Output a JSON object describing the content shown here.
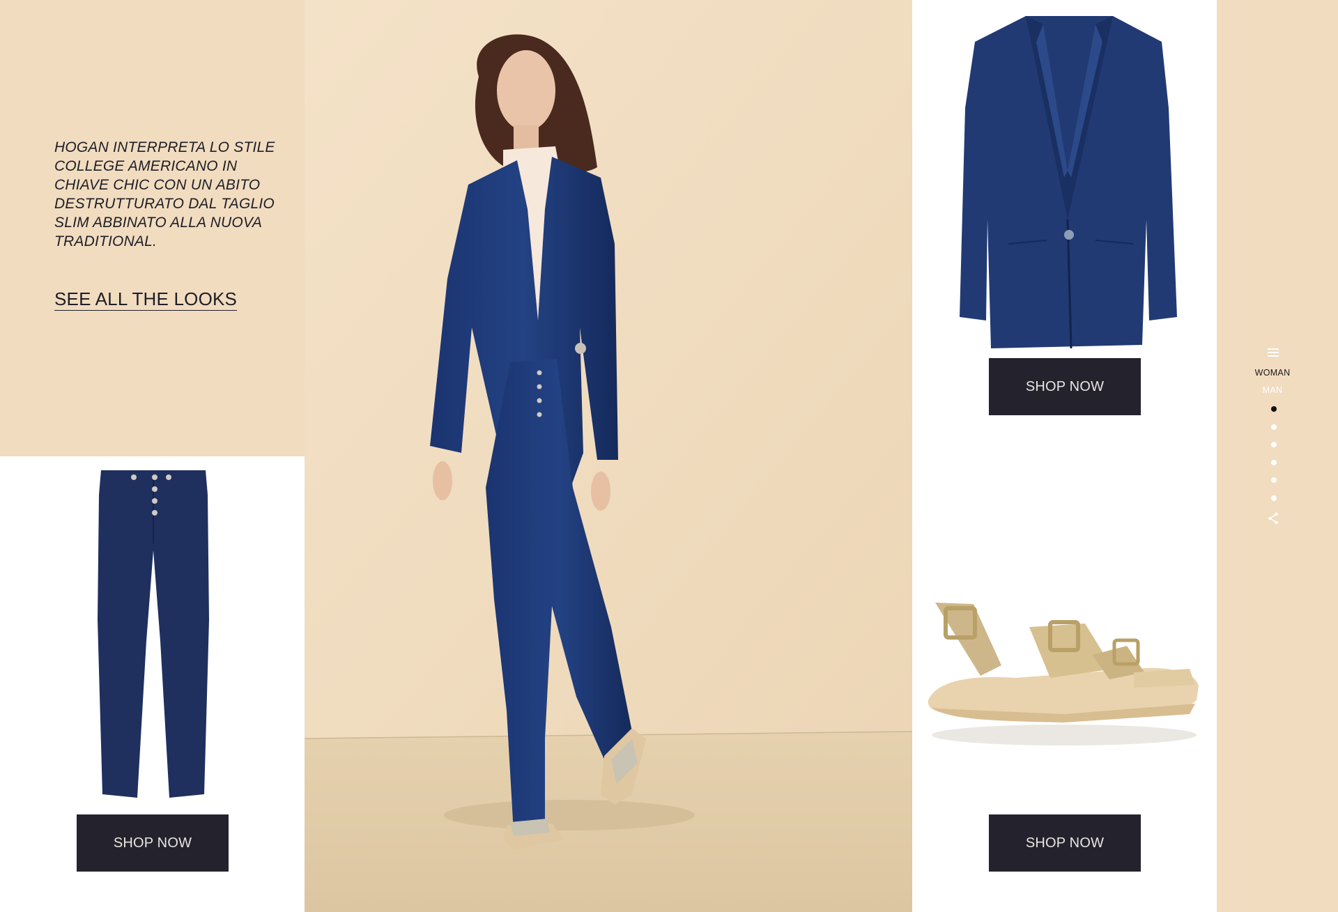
{
  "intro": {
    "text": "HOGAN INTERPRETA LO STILE COLLEGE AMERICANO IN CHIAVE CHIC CON UN ABITO DESTRUTTURATO DAL TAGLIO SLIM ABBINATO ALLA NUOVA TRADITIONAL.",
    "cta": "SEE ALL THE LOOKS"
  },
  "products": [
    {
      "name": "trousers",
      "button": "SHOP NOW",
      "color": "#1f2f5e"
    },
    {
      "name": "blazer",
      "button": "SHOP NOW",
      "color": "#213a73"
    },
    {
      "name": "sandal",
      "button": "SHOP NOW",
      "color": "#cdb78a"
    }
  ],
  "nav": {
    "menu_icon": "hamburger-icon",
    "woman": "WOMAN",
    "man": "MAN",
    "slides": 6,
    "active_slide": 1,
    "share_icon": "share-icon"
  },
  "colors": {
    "background": "#f1dcc0",
    "button": "#24232d",
    "text": "#1e1e26"
  }
}
